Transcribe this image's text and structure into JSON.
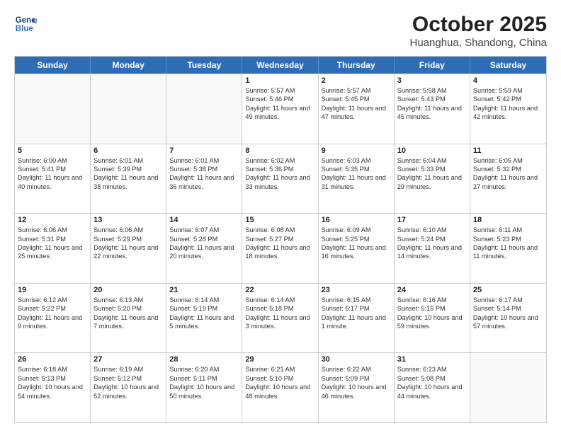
{
  "logo": {
    "line1": "General",
    "line2": "Blue"
  },
  "title": "October 2025",
  "subtitle": "Huanghua, Shandong, China",
  "days_of_week": [
    "Sunday",
    "Monday",
    "Tuesday",
    "Wednesday",
    "Thursday",
    "Friday",
    "Saturday"
  ],
  "weeks": [
    [
      {
        "day": "",
        "text": ""
      },
      {
        "day": "",
        "text": ""
      },
      {
        "day": "",
        "text": ""
      },
      {
        "day": "1",
        "text": "Sunrise: 5:57 AM\nSunset: 5:46 PM\nDaylight: 11 hours\nand 49 minutes."
      },
      {
        "day": "2",
        "text": "Sunrise: 5:57 AM\nSunset: 5:45 PM\nDaylight: 11 hours\nand 47 minutes."
      },
      {
        "day": "3",
        "text": "Sunrise: 5:58 AM\nSunset: 5:43 PM\nDaylight: 11 hours\nand 45 minutes."
      },
      {
        "day": "4",
        "text": "Sunrise: 5:59 AM\nSunset: 5:42 PM\nDaylight: 11 hours\nand 42 minutes."
      }
    ],
    [
      {
        "day": "5",
        "text": "Sunrise: 6:00 AM\nSunset: 5:41 PM\nDaylight: 11 hours\nand 40 minutes."
      },
      {
        "day": "6",
        "text": "Sunrise: 6:01 AM\nSunset: 5:39 PM\nDaylight: 11 hours\nand 38 minutes."
      },
      {
        "day": "7",
        "text": "Sunrise: 6:01 AM\nSunset: 5:38 PM\nDaylight: 11 hours\nand 36 minutes."
      },
      {
        "day": "8",
        "text": "Sunrise: 6:02 AM\nSunset: 5:36 PM\nDaylight: 11 hours\nand 33 minutes."
      },
      {
        "day": "9",
        "text": "Sunrise: 6:03 AM\nSunset: 5:35 PM\nDaylight: 11 hours\nand 31 minutes."
      },
      {
        "day": "10",
        "text": "Sunrise: 6:04 AM\nSunset: 5:33 PM\nDaylight: 11 hours\nand 29 minutes."
      },
      {
        "day": "11",
        "text": "Sunrise: 6:05 AM\nSunset: 5:32 PM\nDaylight: 11 hours\nand 27 minutes."
      }
    ],
    [
      {
        "day": "12",
        "text": "Sunrise: 6:06 AM\nSunset: 5:31 PM\nDaylight: 11 hours\nand 25 minutes."
      },
      {
        "day": "13",
        "text": "Sunrise: 6:06 AM\nSunset: 5:29 PM\nDaylight: 11 hours\nand 22 minutes."
      },
      {
        "day": "14",
        "text": "Sunrise: 6:07 AM\nSunset: 5:28 PM\nDaylight: 11 hours\nand 20 minutes."
      },
      {
        "day": "15",
        "text": "Sunrise: 6:08 AM\nSunset: 5:27 PM\nDaylight: 11 hours\nand 18 minutes."
      },
      {
        "day": "16",
        "text": "Sunrise: 6:09 AM\nSunset: 5:25 PM\nDaylight: 11 hours\nand 16 minutes."
      },
      {
        "day": "17",
        "text": "Sunrise: 6:10 AM\nSunset: 5:24 PM\nDaylight: 11 hours\nand 14 minutes."
      },
      {
        "day": "18",
        "text": "Sunrise: 6:11 AM\nSunset: 5:23 PM\nDaylight: 11 hours\nand 11 minutes."
      }
    ],
    [
      {
        "day": "19",
        "text": "Sunrise: 6:12 AM\nSunset: 5:22 PM\nDaylight: 11 hours\nand 9 minutes."
      },
      {
        "day": "20",
        "text": "Sunrise: 6:13 AM\nSunset: 5:20 PM\nDaylight: 11 hours\nand 7 minutes."
      },
      {
        "day": "21",
        "text": "Sunrise: 6:14 AM\nSunset: 5:19 PM\nDaylight: 11 hours\nand 5 minutes."
      },
      {
        "day": "22",
        "text": "Sunrise: 6:14 AM\nSunset: 5:18 PM\nDaylight: 11 hours\nand 3 minutes."
      },
      {
        "day": "23",
        "text": "Sunrise: 6:15 AM\nSunset: 5:17 PM\nDaylight: 11 hours\nand 1 minute."
      },
      {
        "day": "24",
        "text": "Sunrise: 6:16 AM\nSunset: 5:15 PM\nDaylight: 10 hours\nand 59 minutes."
      },
      {
        "day": "25",
        "text": "Sunrise: 6:17 AM\nSunset: 5:14 PM\nDaylight: 10 hours\nand 57 minutes."
      }
    ],
    [
      {
        "day": "26",
        "text": "Sunrise: 6:18 AM\nSunset: 5:13 PM\nDaylight: 10 hours\nand 54 minutes."
      },
      {
        "day": "27",
        "text": "Sunrise: 6:19 AM\nSunset: 5:12 PM\nDaylight: 10 hours\nand 52 minutes."
      },
      {
        "day": "28",
        "text": "Sunrise: 6:20 AM\nSunset: 5:11 PM\nDaylight: 10 hours\nand 50 minutes."
      },
      {
        "day": "29",
        "text": "Sunrise: 6:21 AM\nSunset: 5:10 PM\nDaylight: 10 hours\nand 48 minutes."
      },
      {
        "day": "30",
        "text": "Sunrise: 6:22 AM\nSunset: 5:09 PM\nDaylight: 10 hours\nand 46 minutes."
      },
      {
        "day": "31",
        "text": "Sunrise: 6:23 AM\nSunset: 5:08 PM\nDaylight: 10 hours\nand 44 minutes."
      },
      {
        "day": "",
        "text": ""
      }
    ]
  ]
}
